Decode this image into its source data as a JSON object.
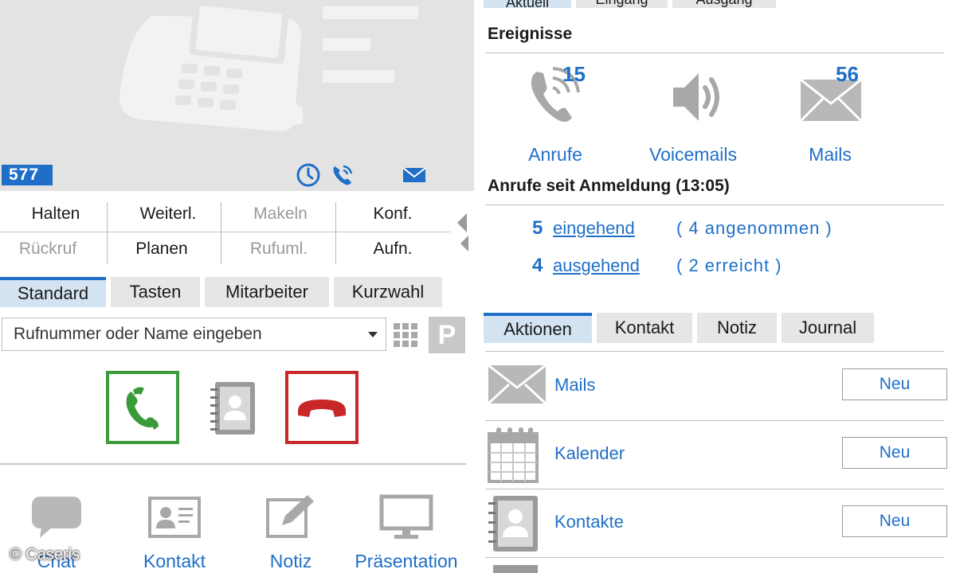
{
  "phone": {
    "extension": "577"
  },
  "functions": [
    {
      "label": "Halten",
      "enabled": true
    },
    {
      "label": "Weiterl.",
      "enabled": true
    },
    {
      "label": "Makeln",
      "enabled": false
    },
    {
      "label": "Konf.",
      "enabled": true
    },
    {
      "label": "Rückruf",
      "enabled": false
    },
    {
      "label": "Planen",
      "enabled": true
    },
    {
      "label": "Rufuml.",
      "enabled": false
    },
    {
      "label": "Aufn.",
      "enabled": true
    }
  ],
  "left_tabs": [
    {
      "label": "Standard",
      "active": true
    },
    {
      "label": "Tasten",
      "active": false
    },
    {
      "label": "Mitarbeiter",
      "active": false
    },
    {
      "label": "Kurzwahl",
      "active": false
    }
  ],
  "dial": {
    "placeholder": "Rufnummer oder Name eingeben",
    "park_label": "P"
  },
  "bottom_actions": [
    {
      "label": "Chat",
      "icon": "chat-bubble-icon"
    },
    {
      "label": "Kontakt",
      "icon": "contact-card-icon"
    },
    {
      "label": "Notiz",
      "icon": "note-edit-icon"
    },
    {
      "label": "Präsentation",
      "icon": "monitor-icon"
    }
  ],
  "watermark": "© Caseris",
  "right": {
    "top_tabs": [
      "Aktuell",
      "Eingang",
      "Ausgang"
    ],
    "events_title": "Ereignisse",
    "events": [
      {
        "label": "Anrufe",
        "count": "15",
        "icon": "phone-ringing-icon"
      },
      {
        "label": "Voicemails",
        "count": "",
        "icon": "speaker-icon"
      },
      {
        "label": "Mails",
        "count": "56",
        "icon": "envelope-icon"
      }
    ],
    "calls_title": "Anrufe seit Anmeldung (13:05)",
    "calls": [
      {
        "count": "5",
        "link": "eingehend",
        "note": "( 4 angenommen )"
      },
      {
        "count": "4",
        "link": "ausgehend",
        "note": "( 2 erreicht )"
      }
    ],
    "action_tabs": [
      {
        "label": "Aktionen",
        "active": true
      },
      {
        "label": "Kontakt",
        "active": false
      },
      {
        "label": "Notiz",
        "active": false
      },
      {
        "label": "Journal",
        "active": false
      }
    ],
    "actions": [
      {
        "label": "Mails",
        "button": "Neu",
        "icon": "envelope-icon"
      },
      {
        "label": "Kalender",
        "button": "Neu",
        "icon": "calendar-icon"
      },
      {
        "label": "Kontakte",
        "button": "Neu",
        "icon": "address-book-icon"
      }
    ]
  },
  "colors": {
    "accent": "#1f6fc8",
    "call_green": "#3a9b3a",
    "hangup_red": "#c82828",
    "panel_gray": "#e3e3e3"
  }
}
